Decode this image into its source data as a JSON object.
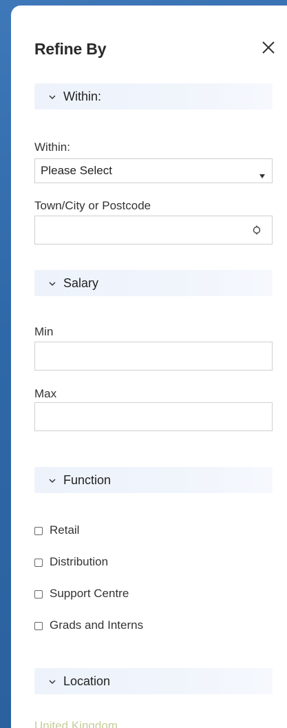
{
  "panel": {
    "title": "Refine By"
  },
  "sections": {
    "within": {
      "label": "Within:"
    },
    "salary": {
      "label": "Salary"
    },
    "function": {
      "label": "Function"
    },
    "location": {
      "label": "Location"
    }
  },
  "within": {
    "label": "Within:",
    "selected": "Please Select"
  },
  "town": {
    "label": "Town/City or Postcode",
    "value": ""
  },
  "salary": {
    "min_label": "Min",
    "max_label": "Max",
    "min_value": "",
    "max_value": ""
  },
  "function_options": [
    "Retail",
    "Distribution",
    "Support Centre",
    "Grads and Interns"
  ],
  "location": {
    "first_option": "United Kingdom"
  },
  "icons": {
    "close": "close-icon",
    "chevron": "chevron-down-icon",
    "caret": "caret-down-icon",
    "locate": "locate-icon"
  },
  "colors": {
    "background": "#2f68a8",
    "section_bar": "#eef3fb",
    "link": "#9aa64a"
  }
}
